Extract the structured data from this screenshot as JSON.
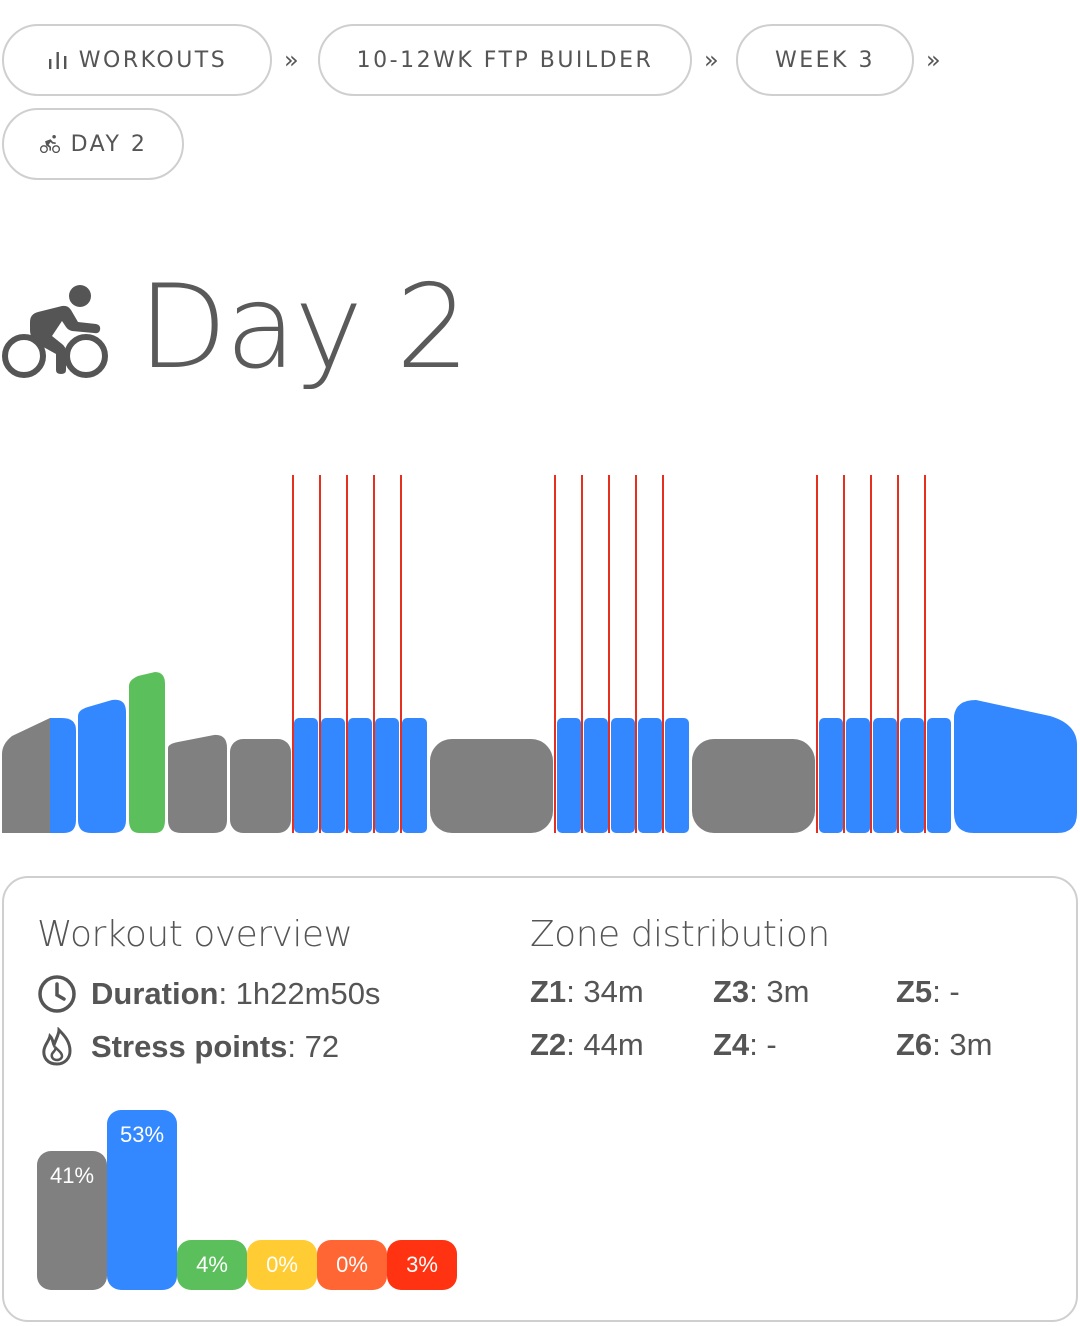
{
  "breadcrumb": {
    "items": [
      {
        "label": "WORKOUTS",
        "icon": "bar-chart-icon"
      },
      {
        "label": "10-12WK FTP BUILDER"
      },
      {
        "label": "WEEK 3"
      },
      {
        "label": "DAY 2",
        "icon": "cyclist-icon"
      }
    ],
    "separator": "»"
  },
  "page": {
    "title": "Day 2",
    "title_icon": "cyclist-icon"
  },
  "colors": {
    "z1": "#808080",
    "z2": "#3388ff",
    "z3": "#5bbf5b",
    "z4": "#ffcc33",
    "z5": "#ff6633",
    "z6": "#ff3311",
    "interval_line": "#e53020"
  },
  "overview": {
    "title": "Workout overview",
    "duration_label": "Duration",
    "duration_value": ": 1h22m50s",
    "stress_label": "Stress points",
    "stress_value": ": 72"
  },
  "zones": {
    "title": "Zone distribution",
    "items": [
      {
        "label": "Z1",
        "value": ": 34m"
      },
      {
        "label": "Z2",
        "value": ": 44m"
      },
      {
        "label": "Z3",
        "value": ": 3m"
      },
      {
        "label": "Z4",
        "value": ": -"
      },
      {
        "label": "Z5",
        "value": ": -"
      },
      {
        "label": "Z6",
        "value": ": 3m"
      }
    ]
  },
  "chart_data": {
    "type": "bar",
    "categories": [
      "Z1",
      "Z2",
      "Z3",
      "Z4",
      "Z5",
      "Z6"
    ],
    "values": [
      41,
      53,
      4,
      0,
      0,
      3
    ],
    "labels": [
      "41%",
      "53%",
      "4%",
      "0%",
      "0%",
      "3%"
    ]
  }
}
